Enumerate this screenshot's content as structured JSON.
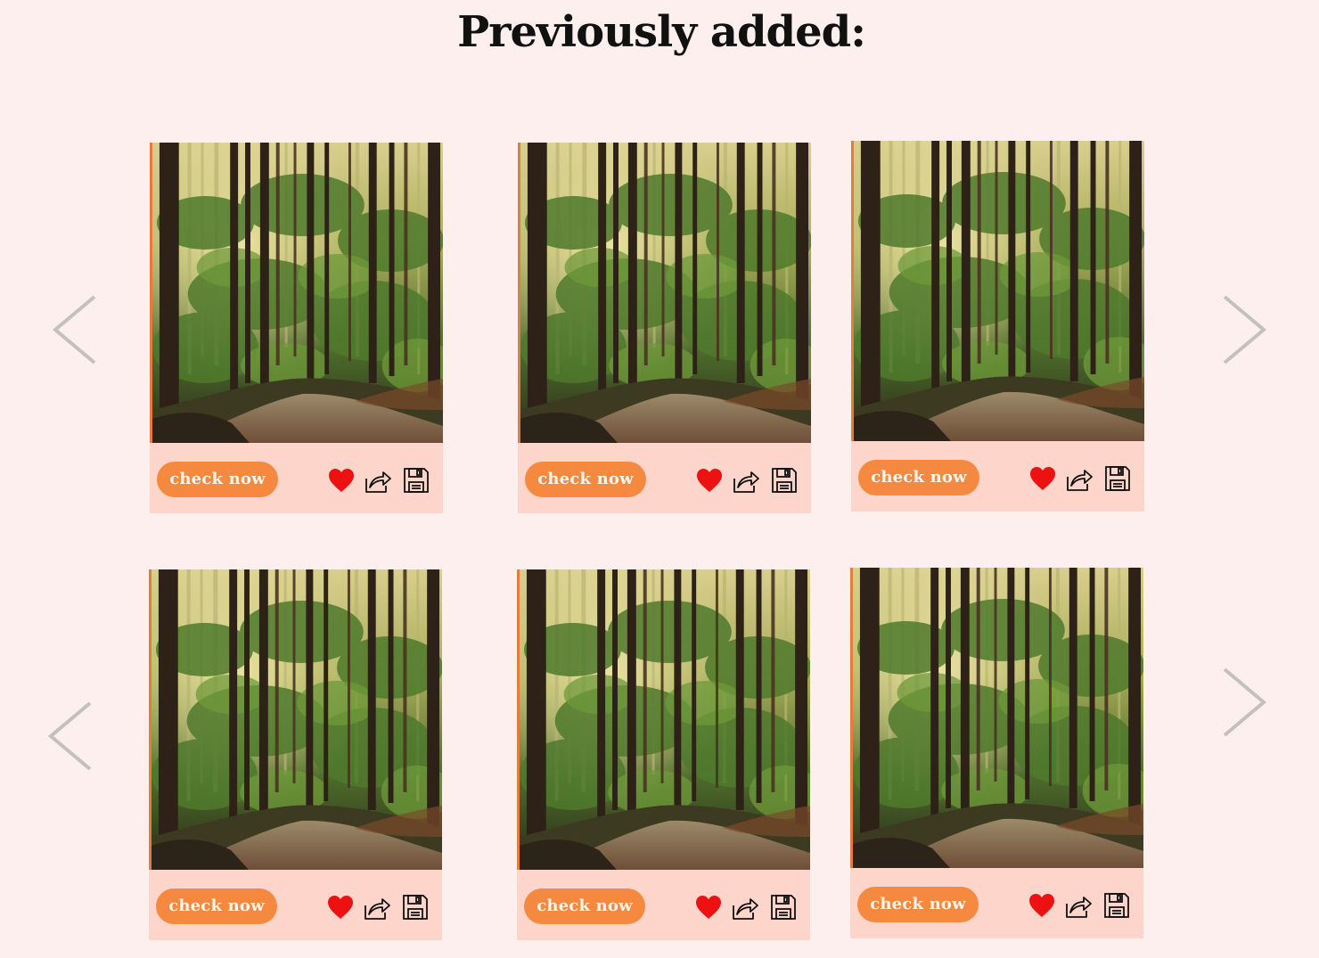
{
  "heading": "Previously added:",
  "colors": {
    "background": "#fcefee",
    "card": "#fdd5cb",
    "button": "#f5893f",
    "heart": "#ee1111",
    "arrow": "#c4c0bf"
  },
  "icons": {
    "prev": "chevron-left-icon",
    "next": "chevron-right-icon",
    "like": "heart-icon",
    "share": "share-icon",
    "save": "floppy-disk-icon"
  },
  "rows": [
    {
      "cards": [
        {
          "button_label": "check now"
        },
        {
          "button_label": "check now"
        },
        {
          "button_label": "check now"
        }
      ]
    },
    {
      "cards": [
        {
          "button_label": "check now"
        },
        {
          "button_label": "check now"
        },
        {
          "button_label": "check now"
        }
      ]
    }
  ]
}
